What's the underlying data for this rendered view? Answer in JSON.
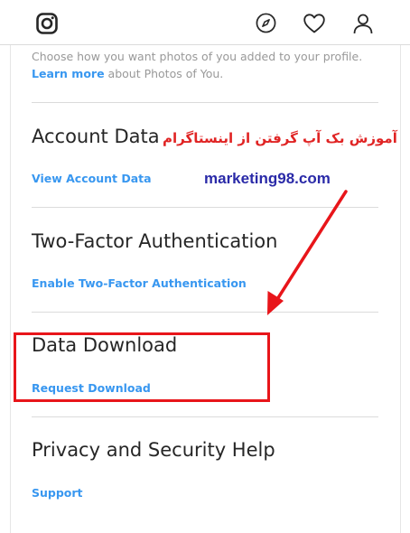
{
  "header": {
    "logo_icon": "instagram-icon",
    "explore_icon": "compass-icon",
    "activity_icon": "heart-icon",
    "profile_icon": "person-icon"
  },
  "photos_of_you": {
    "hint_text": "Choose how you want photos of you added to your profile.",
    "learn_more_label": "Learn more",
    "learn_more_suffix": " about Photos of You."
  },
  "sections": {
    "account_data": {
      "title": "Account Data",
      "link": "View Account Data"
    },
    "two_factor": {
      "title": "Two-Factor Authentication",
      "link": "Enable Two-Factor Authentication"
    },
    "data_download": {
      "title": "Data Download",
      "link": "Request Download"
    },
    "privacy_help": {
      "title": "Privacy and Security Help",
      "link": "Support"
    }
  },
  "overlay": {
    "persian_caption": "آموزش بک آپ گرفتن از اینستاگرام",
    "watermark": "marketing98.com",
    "accent_color": "#e8151a",
    "watermark_color": "#2a2aa8"
  },
  "colors": {
    "link": "#3897f0",
    "title": "#262626",
    "hint": "#999999",
    "divider": "#dbdbdb"
  }
}
